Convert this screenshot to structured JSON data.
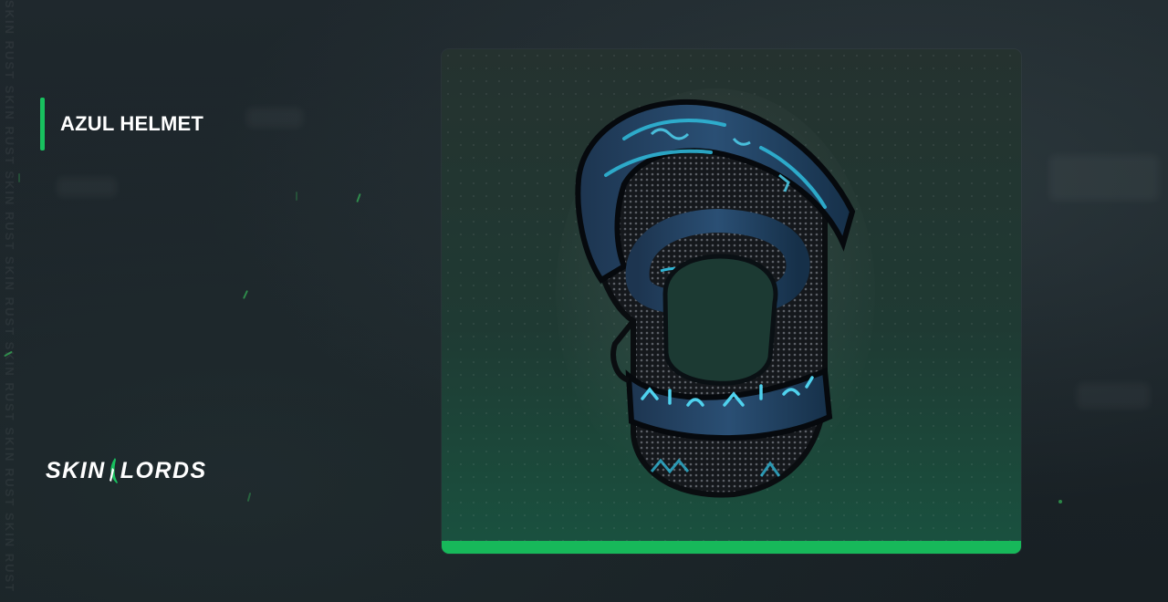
{
  "item": {
    "title": "AZUL HELMET",
    "image_icon": "helmet-image"
  },
  "brand": {
    "logo_text_left": "SKIN",
    "logo_text_right": "LORDS",
    "watermark": "SKIN RUST SKIN RUST SKIN RUST SKIN RUST SKIN RUST SKIN RUST SKIN RUST"
  },
  "colors": {
    "accent": "#18c15e",
    "background": "#1b2328",
    "card_top": "#25322f",
    "card_bottom": "#1a5240",
    "helmet_glow": "#2fb6d6"
  }
}
